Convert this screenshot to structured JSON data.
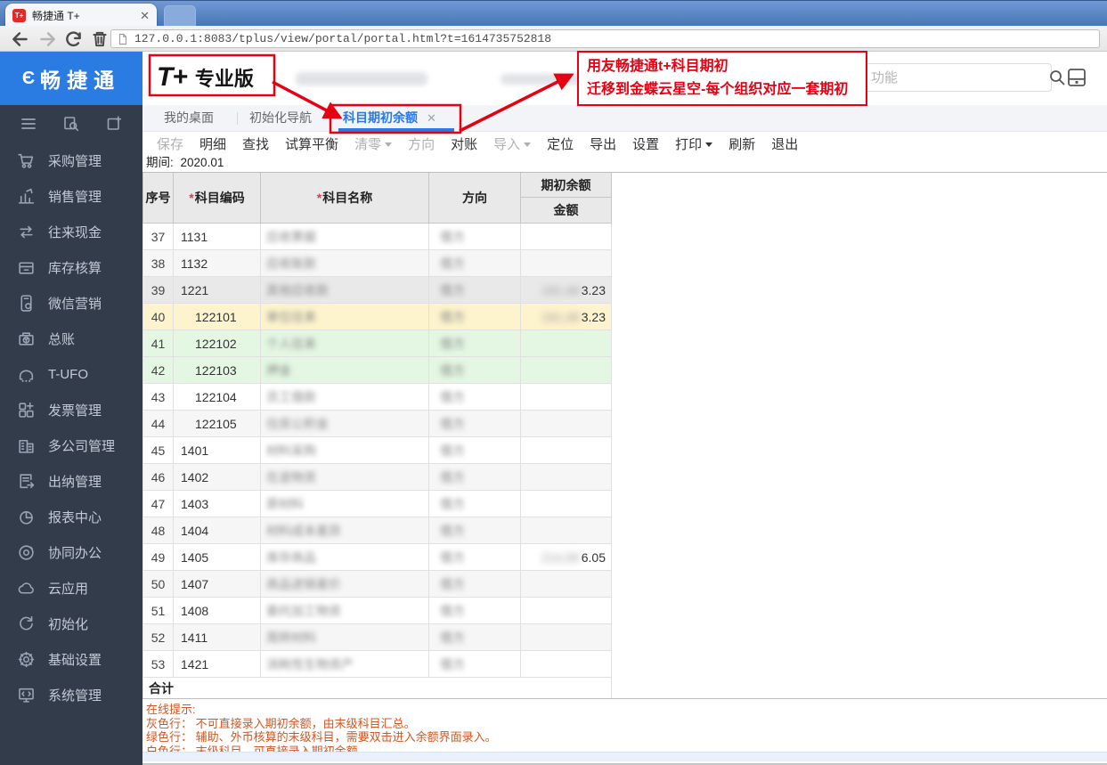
{
  "browser": {
    "tab_title": "畅捷通 T+",
    "favicon_text": "T+",
    "url": "127.0.0.1:8083/tplus/view/portal/portal.html?t=1614735752818"
  },
  "header": {
    "brand_glyph": "Є",
    "brand": "畅捷通",
    "logo_mark": "T+",
    "logo_edition": "专业版",
    "search_placeholder": "功能"
  },
  "tabs": [
    {
      "label": "我的桌面",
      "active": false,
      "closable": false
    },
    {
      "label": "初始化导航",
      "active": false,
      "closable": false
    },
    {
      "label": "科目期初余额",
      "active": true,
      "closable": true,
      "close_glyph": "✕"
    }
  ],
  "toolbar": [
    {
      "label": "保存",
      "disabled": true,
      "caret": false
    },
    {
      "label": "明细",
      "disabled": false,
      "caret": false
    },
    {
      "label": "查找",
      "disabled": false,
      "caret": false
    },
    {
      "label": "试算平衡",
      "disabled": false,
      "caret": false
    },
    {
      "label": "清零",
      "disabled": true,
      "caret": true
    },
    {
      "label": "方向",
      "disabled": true,
      "caret": false
    },
    {
      "label": "对账",
      "disabled": false,
      "caret": false
    },
    {
      "label": "导入",
      "disabled": true,
      "caret": true
    },
    {
      "label": "定位",
      "disabled": false,
      "caret": false
    },
    {
      "label": "导出",
      "disabled": false,
      "caret": false
    },
    {
      "label": "设置",
      "disabled": false,
      "caret": false
    },
    {
      "label": "打印",
      "disabled": false,
      "caret": true
    },
    {
      "label": "刷新",
      "disabled": false,
      "caret": false
    },
    {
      "label": "退出",
      "disabled": false,
      "caret": false
    }
  ],
  "period": {
    "label": "期间:",
    "value": "2020.01"
  },
  "table": {
    "headers": {
      "seq": "序号",
      "code": "科目编码",
      "name": "科目名称",
      "direction": "方向",
      "balance_group": "期初余额",
      "amount": "金额",
      "required_mark": "*"
    },
    "total_label": "合计",
    "rows": [
      {
        "seq": "37",
        "code": "1131",
        "name": "应收票据",
        "direction": "借方",
        "amount_blur": "",
        "amount_tail": "",
        "type": "white",
        "indent": false
      },
      {
        "seq": "38",
        "code": "1132",
        "name": "应收账款",
        "direction": "借方",
        "amount_blur": "",
        "amount_tail": "",
        "type": "stripe",
        "indent": false
      },
      {
        "seq": "39",
        "code": "1221",
        "name": "其他应收款",
        "direction": "借方",
        "amount_blur": "181,48",
        "amount_tail": "3.23",
        "type": "gray",
        "indent": false
      },
      {
        "seq": "40",
        "code": "122101",
        "name": "单位往来",
        "direction": "借方",
        "amount_blur": "181,48",
        "amount_tail": "3.23",
        "type": "selected",
        "indent": true
      },
      {
        "seq": "41",
        "code": "122102",
        "name": "个人往来",
        "direction": "借方",
        "amount_blur": "",
        "amount_tail": "",
        "type": "green",
        "indent": true
      },
      {
        "seq": "42",
        "code": "122103",
        "name": "押金",
        "direction": "借方",
        "amount_blur": "",
        "amount_tail": "",
        "type": "green",
        "indent": true
      },
      {
        "seq": "43",
        "code": "122104",
        "name": "员工借款",
        "direction": "借方",
        "amount_blur": "",
        "amount_tail": "",
        "type": "white",
        "indent": true
      },
      {
        "seq": "44",
        "code": "122105",
        "name": "住房公积金",
        "direction": "借方",
        "amount_blur": "",
        "amount_tail": "",
        "type": "stripe",
        "indent": true
      },
      {
        "seq": "45",
        "code": "1401",
        "name": "材料采购",
        "direction": "借方",
        "amount_blur": "",
        "amount_tail": "",
        "type": "white",
        "indent": false
      },
      {
        "seq": "46",
        "code": "1402",
        "name": "在途物资",
        "direction": "借方",
        "amount_blur": "",
        "amount_tail": "",
        "type": "stripe",
        "indent": false
      },
      {
        "seq": "47",
        "code": "1403",
        "name": "原材料",
        "direction": "借方",
        "amount_blur": "",
        "amount_tail": "",
        "type": "white",
        "indent": false
      },
      {
        "seq": "48",
        "code": "1404",
        "name": "材料成本差异",
        "direction": "借方",
        "amount_blur": "",
        "amount_tail": "",
        "type": "stripe",
        "indent": false
      },
      {
        "seq": "49",
        "code": "1405",
        "name": "库存商品",
        "direction": "借方",
        "amount_blur": "214,99",
        "amount_tail": "6.05",
        "type": "white",
        "indent": false
      },
      {
        "seq": "50",
        "code": "1407",
        "name": "商品进销差价",
        "direction": "借方",
        "amount_blur": "",
        "amount_tail": "",
        "type": "stripe",
        "indent": false
      },
      {
        "seq": "51",
        "code": "1408",
        "name": "委托加工物资",
        "direction": "借方",
        "amount_blur": "",
        "amount_tail": "",
        "type": "white",
        "indent": false
      },
      {
        "seq": "52",
        "code": "1411",
        "name": "周转材料",
        "direction": "借方",
        "amount_blur": "",
        "amount_tail": "",
        "type": "stripe",
        "indent": false
      },
      {
        "seq": "53",
        "code": "1421",
        "name": "消耗性生物资产",
        "direction": "借方",
        "amount_blur": "",
        "amount_tail": "",
        "type": "white",
        "indent": false
      }
    ]
  },
  "hints": {
    "title": "在线提示:",
    "lines": [
      "灰色行：  不可直接录入期初余额，由末级科目汇总。",
      "绿色行：  辅助、外币核算的末级科目，需要双击进入余额界面录入。",
      "白色行：  末级科目，可直接录入期初余额。"
    ]
  },
  "annotation": {
    "line1": "用友畅捷通t+科目期初",
    "line2": "迁移到金蝶云星空-每个组织对应一套期初"
  },
  "sidebar": {
    "items": [
      {
        "label": "采购管理",
        "icon": "cart-icon"
      },
      {
        "label": "销售管理",
        "icon": "sales-chart-icon"
      },
      {
        "label": "往来现金",
        "icon": "swap-arrows-icon"
      },
      {
        "label": "库存核算",
        "icon": "inventory-box-icon"
      },
      {
        "label": "微信营销",
        "icon": "wechat-phone-icon"
      },
      {
        "label": "总账",
        "icon": "ledger-icon"
      },
      {
        "label": "T-UFO",
        "icon": "ufo-icon"
      },
      {
        "label": "发票管理",
        "icon": "invoice-grid-icon"
      },
      {
        "label": "多公司管理",
        "icon": "company-building-icon"
      },
      {
        "label": "出纳管理",
        "icon": "cashier-doc-icon"
      },
      {
        "label": "报表中心",
        "icon": "report-pie-icon"
      },
      {
        "label": "协同办公",
        "icon": "collab-target-icon"
      },
      {
        "label": "云应用",
        "icon": "cloud-icon"
      },
      {
        "label": "初始化",
        "icon": "init-redo-icon"
      },
      {
        "label": "基础设置",
        "icon": "gear-icon"
      },
      {
        "label": "系统管理",
        "icon": "system-monitor-icon"
      }
    ]
  },
  "colors": {
    "accent_blue": "#2a7ae2",
    "brand_blue": "#2a7ce2",
    "annotation_red": "#e60012",
    "hint_orange": "#d4551f",
    "row_selected": "#fdf3cd",
    "row_green": "#e3f7e3",
    "row_gray": "#e9e9e9",
    "sidebar_bg": "#333c4b"
  }
}
